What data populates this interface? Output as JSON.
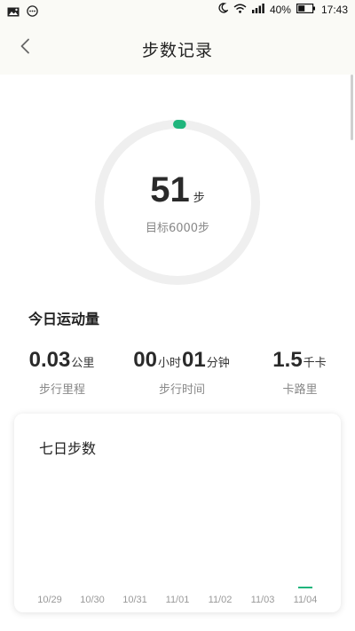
{
  "status_bar": {
    "battery": "40%",
    "time": "17:43",
    "icons": [
      "image-icon",
      "message-icon",
      "moon-icon",
      "wifi-icon",
      "signal-icon",
      "battery-icon"
    ]
  },
  "nav": {
    "title": "步数记录",
    "back_icon": "chevron-left-icon"
  },
  "ring": {
    "steps": "51",
    "steps_unit": "步",
    "goal_text": "目标6000步",
    "progress": 0.0085,
    "track_color": "#efefef",
    "progress_color": "#1fb57c"
  },
  "today": {
    "title": "今日运动量",
    "distance": {
      "value": "0.03",
      "unit": "公里",
      "label": "步行里程"
    },
    "duration": {
      "hours": "00",
      "hours_unit": "小时",
      "minutes": "01",
      "minutes_unit": "分钟",
      "label": "步行时间"
    },
    "calories": {
      "value": "1.5",
      "unit": "千卡",
      "label": "卡路里"
    }
  },
  "weekly": {
    "title": "七日步数",
    "days": [
      "10/29",
      "10/30",
      "10/31",
      "11/01",
      "11/02",
      "11/03",
      "11/04"
    ],
    "steps": [
      0,
      0,
      0,
      0,
      0,
      0,
      51
    ],
    "accent": "#1fb57c"
  }
}
